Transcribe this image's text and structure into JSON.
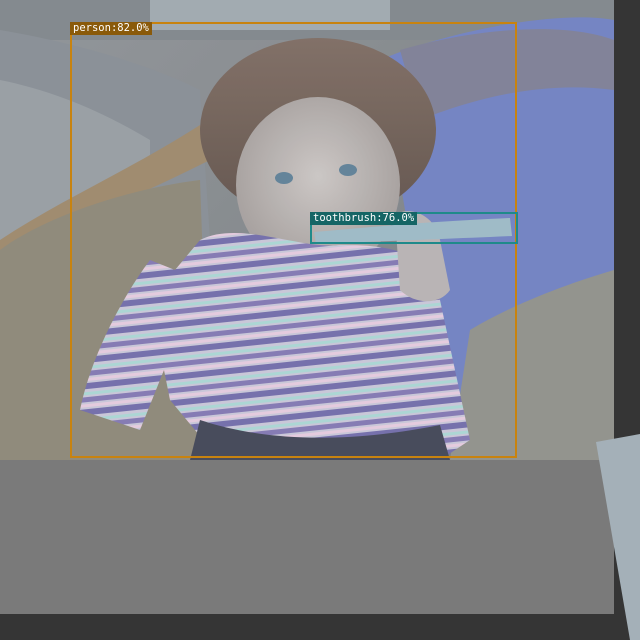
{
  "detections": [
    {
      "label": "person",
      "score": "82.0%",
      "color": "#c8830f"
    },
    {
      "label": "toothbrush",
      "score": "76.0%",
      "color": "#1f8a8a"
    }
  ],
  "colors": {
    "page_background": "#353535",
    "padding_fill": "#7a7a7a"
  }
}
